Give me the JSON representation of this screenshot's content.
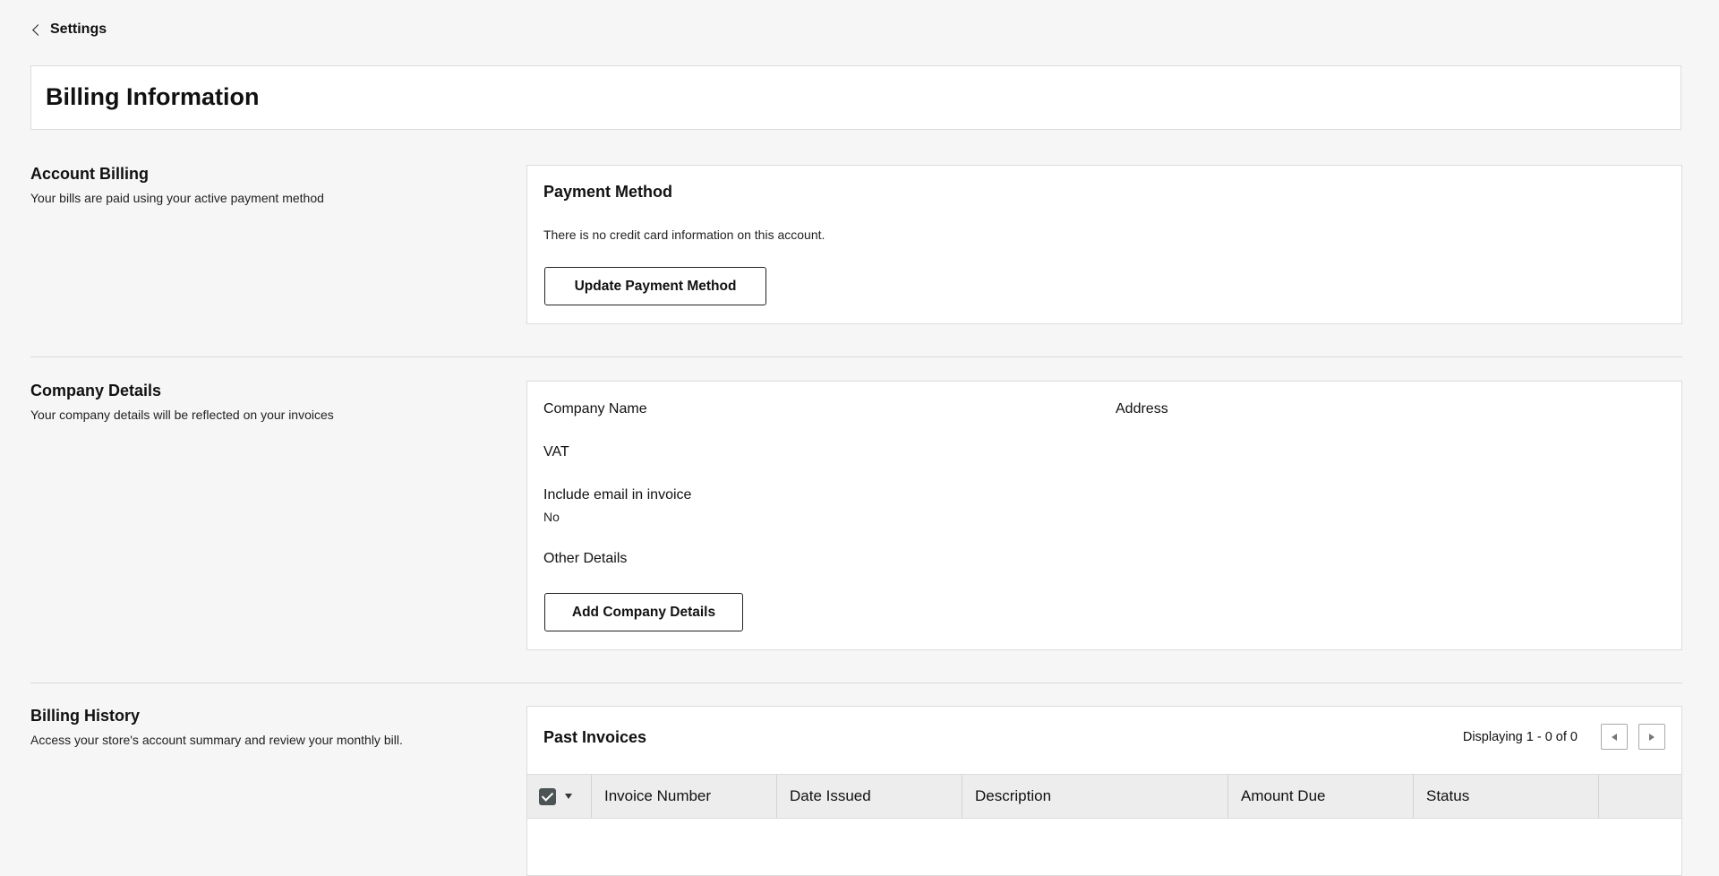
{
  "nav": {
    "back_label": "Settings"
  },
  "header": {
    "title": "Billing Information"
  },
  "account_billing": {
    "title": "Account Billing",
    "description": "Your bills are paid using your active payment method",
    "card_title": "Payment Method",
    "card_text": "There is no credit card information on this account.",
    "button_label": "Update Payment Method"
  },
  "company_details": {
    "title": "Company Details",
    "description": "Your company details will be reflected on your invoices",
    "fields": {
      "company_name_label": "Company Name",
      "address_label": "Address",
      "vat_label": "VAT",
      "include_email_label": "Include email in invoice",
      "include_email_value": "No",
      "other_details_label": "Other Details"
    },
    "button_label": "Add Company Details"
  },
  "billing_history": {
    "title": "Billing History",
    "description": "Access your store's account summary and review your monthly bill.",
    "card_title": "Past Invoices",
    "pagination_text": "Displaying 1 - 0 of 0",
    "columns": [
      "Invoice Number",
      "Date Issued",
      "Description",
      "Amount Due",
      "Status"
    ],
    "rows": []
  },
  "icons": {
    "back": "chevron-left-icon",
    "prev": "triangle-left-icon",
    "next": "triangle-right-icon",
    "select_all": "checkbox-checked-icon",
    "select_menu": "caret-down-icon"
  }
}
